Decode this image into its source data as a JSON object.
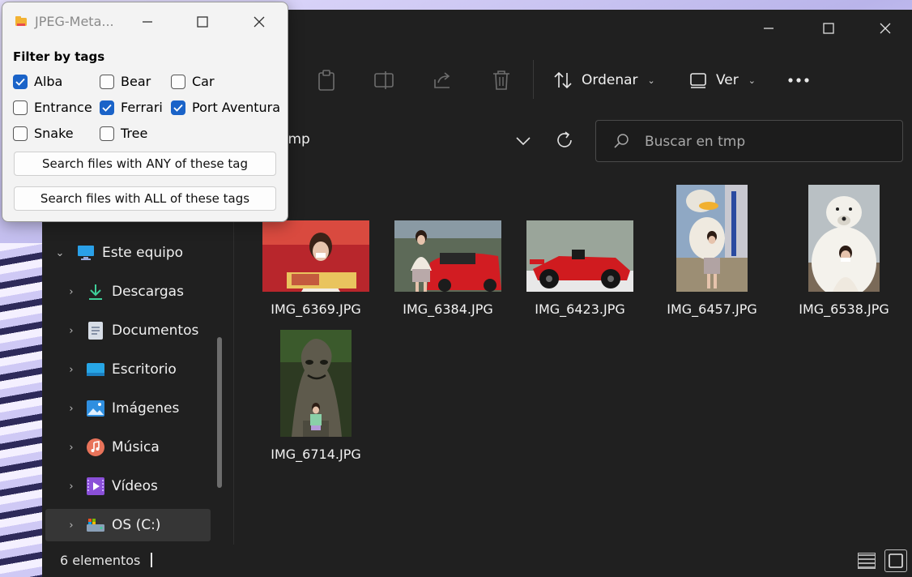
{
  "dialog": {
    "title": "JPEG-Meta...",
    "heading": "Filter by tags",
    "tags": [
      {
        "label": "Alba",
        "checked": true
      },
      {
        "label": "Bear",
        "checked": false
      },
      {
        "label": "Car",
        "checked": false
      },
      {
        "label": "Entrance",
        "checked": false
      },
      {
        "label": "Ferrari",
        "checked": true
      },
      {
        "label": "Port Aventura",
        "checked": true
      },
      {
        "label": "Snake",
        "checked": false
      },
      {
        "label": "Tree",
        "checked": false
      }
    ],
    "search_any_label": "Search files with ANY of these tag",
    "search_all_label": "Search files with ALL of these tags"
  },
  "toolbar": {
    "sort_label": "Ordenar",
    "view_label": "Ver"
  },
  "address": {
    "crumb_separator": "›",
    "current_folder": "tmp"
  },
  "search": {
    "placeholder": "Buscar en tmp"
  },
  "nav": {
    "items": [
      {
        "label": "Este equipo",
        "icon": "computer-icon",
        "expanded": true
      },
      {
        "label": "Descargas",
        "icon": "download-icon"
      },
      {
        "label": "Documentos",
        "icon": "document-icon"
      },
      {
        "label": "Escritorio",
        "icon": "desktop-icon"
      },
      {
        "label": "Imágenes",
        "icon": "pictures-icon"
      },
      {
        "label": "Música",
        "icon": "music-icon"
      },
      {
        "label": "Vídeos",
        "icon": "video-icon"
      },
      {
        "label": "OS (C:)",
        "icon": "drive-icon",
        "selected": true
      }
    ]
  },
  "files": [
    {
      "name": "IMG_6369.JPG"
    },
    {
      "name": "IMG_6384.JPG"
    },
    {
      "name": "IMG_6423.JPG"
    },
    {
      "name": "IMG_6457.JPG"
    },
    {
      "name": "IMG_6538.JPG"
    },
    {
      "name": "IMG_6714.JPG"
    }
  ],
  "status": {
    "count_text": "6 elementos"
  },
  "colors": {
    "explorer_bg": "#202020",
    "accent": "#1a63c8",
    "dialog_bg": "#f3f3f3"
  }
}
